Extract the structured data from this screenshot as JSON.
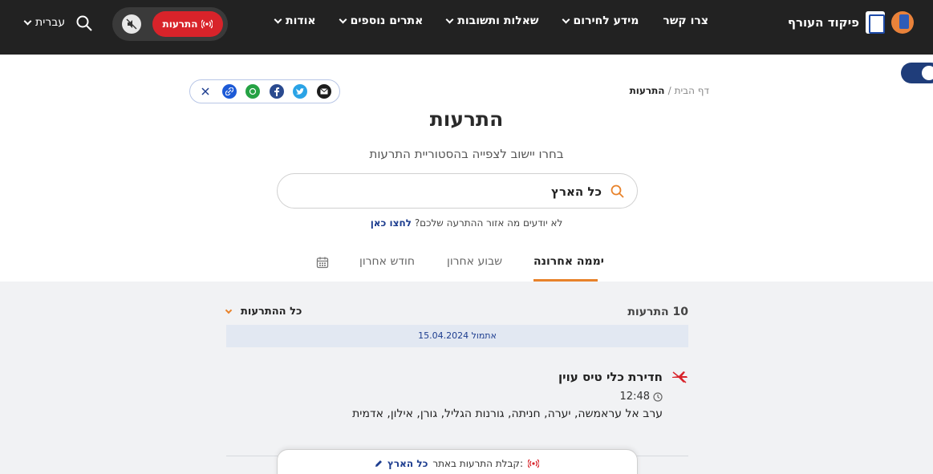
{
  "header": {
    "brand_name": "פיקוד העורף",
    "nav": [
      "צרו קשר",
      "מידע לחירום",
      "שאלות ותשובות",
      "אתרים נוספים",
      "אודות"
    ],
    "alerts_button": "התרעות",
    "language": "עברית"
  },
  "breadcrumb": {
    "home": "דף הבית",
    "separator": "/",
    "current": "התרעות"
  },
  "page": {
    "title": "התרעות",
    "subtitle": "בחרו יישוב לצפייה בהסטוריית התרעות",
    "search_value": "כל הארץ",
    "hint_text": "לא יודעים מה אזור ההתרעה שלכם?",
    "hint_link": "לחצו כאן"
  },
  "tabs": {
    "day": "יממה אחרונה",
    "week": "שבוע אחרון",
    "month": "חודש אחרון"
  },
  "results": {
    "count_label": "10 התרעות",
    "filter_label": "כל ההתרעות",
    "date_label": "אתמול 15.04.2024",
    "alert": {
      "title": "חדירת כלי טיס עוין",
      "time": "12:48",
      "places": "ערב אל עראמשה, יערה, חניתה, גורנות הגליל, גורן, אילון, אדמית"
    }
  },
  "bottom": {
    "label": "קבלת התרעות באתר:",
    "location": "כל הארץ"
  },
  "colors": {
    "topbar": "#222222",
    "alert_red": "#d8232a",
    "accent_orange": "#e8822a",
    "link_blue": "#1d3d8f"
  },
  "icons": [
    "search-icon",
    "mute-icon",
    "broadcast-icon",
    "email-icon",
    "twitter-icon",
    "facebook-icon",
    "whatsapp-icon",
    "link-icon",
    "x-icon",
    "calendar-icon",
    "clock-icon",
    "hostile-aircraft-icon",
    "pencil-icon"
  ]
}
